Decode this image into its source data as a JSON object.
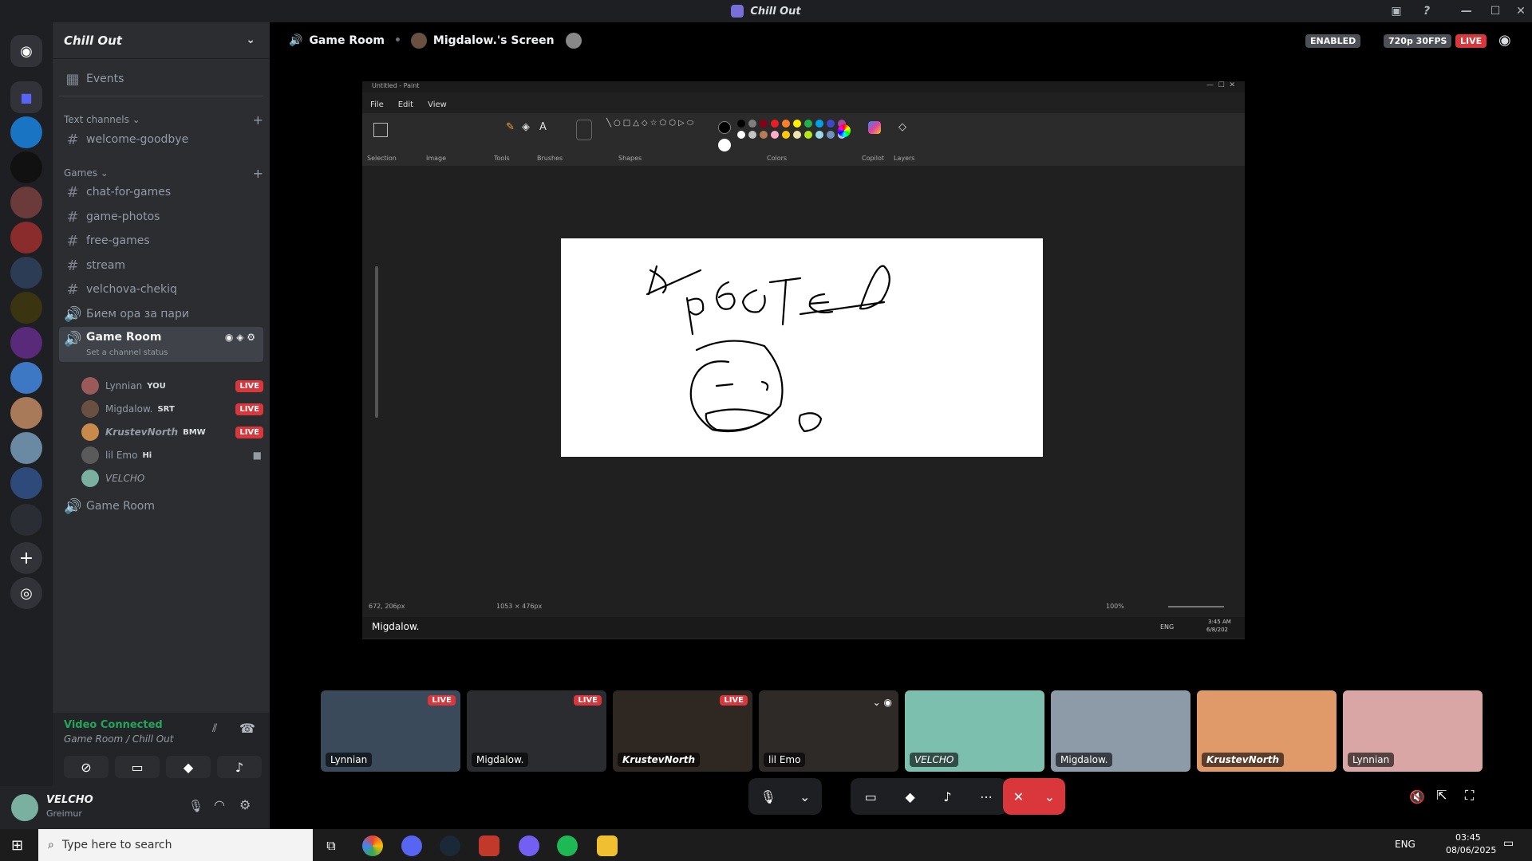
{
  "window": {
    "title": "Chill Out"
  },
  "server": {
    "name": "Chill Out"
  },
  "sidebar": {
    "events_label": "Events",
    "text_category": "Text channels",
    "text_channels": [
      "welcome-goodbye"
    ],
    "games_category": "Games",
    "game_channels": [
      "chat-for-games",
      "game-photos",
      "free-games",
      "stream",
      "velchova-chekiq",
      "Бием ора за пари"
    ],
    "active_voice": {
      "name": "Game Room",
      "status": "Set a channel status"
    },
    "voice_members": [
      {
        "name": "Lynnian",
        "tag": "YOU",
        "live": "LIVE"
      },
      {
        "name": "Migdalow.",
        "tag": "SRT",
        "live": "LIVE"
      },
      {
        "name": "KrustevNorth",
        "tag": "BMW",
        "live": "LIVE"
      },
      {
        "name": "lil Emo",
        "tag": "Hi",
        "live": ""
      },
      {
        "name": "VELCHO",
        "tag": "",
        "live": ""
      }
    ],
    "second_voice": "Game Room"
  },
  "voice_panel": {
    "status": "Video Connected",
    "location": "Game Room / Chill Out"
  },
  "user": {
    "name": "VELCHO",
    "sub": "Greimur"
  },
  "stage": {
    "channel": "Game Room",
    "screen_owner": "Migdalow.'s Screen",
    "enabled_badge": "ENABLED",
    "quality_badge": "720p 30FPS",
    "live_badge": "LIVE"
  },
  "paint": {
    "title": "Untitled - Paint",
    "menu": [
      "File",
      "Edit",
      "View"
    ],
    "groups": [
      "Selection",
      "Image",
      "Tools",
      "Brushes",
      "Shapes",
      "Colors",
      "Copilot",
      "Layers"
    ],
    "cursor_pos": "672, 206px",
    "canvas_size": "1053 × 476px",
    "zoom": "100%",
    "taskbar_app": "Migdalow.",
    "lang": "ENG",
    "clock": "3:45 AM",
    "date": "6/8/202"
  },
  "tiles": [
    {
      "name": "Lynnian",
      "live": "LIVE",
      "color": "#3b4a5a"
    },
    {
      "name": "Migdalow.",
      "live": "LIVE",
      "color": "#2a2c30"
    },
    {
      "name": "KrustevNorth",
      "live": "LIVE",
      "color": "#2f2722"
    },
    {
      "name": "lil Emo",
      "live": "",
      "color": "#2e2a28"
    },
    {
      "name": "VELCHO",
      "live": "",
      "color": "#7dbfae"
    },
    {
      "name": "Migdalow.",
      "live": "",
      "color": "#8d9aa8"
    },
    {
      "name": "KrustevNorth",
      "live": "",
      "color": "#e09a6a"
    },
    {
      "name": "Lynnian",
      "live": "",
      "color": "#d9a5a5"
    }
  ],
  "taskbar": {
    "search_placeholder": "Type here to search",
    "lang": "ENG",
    "time": "03:45",
    "date": "08/06/2025"
  },
  "colors": {
    "live": "#da373c",
    "accent": "#5865f2",
    "connected": "#23a55a"
  }
}
